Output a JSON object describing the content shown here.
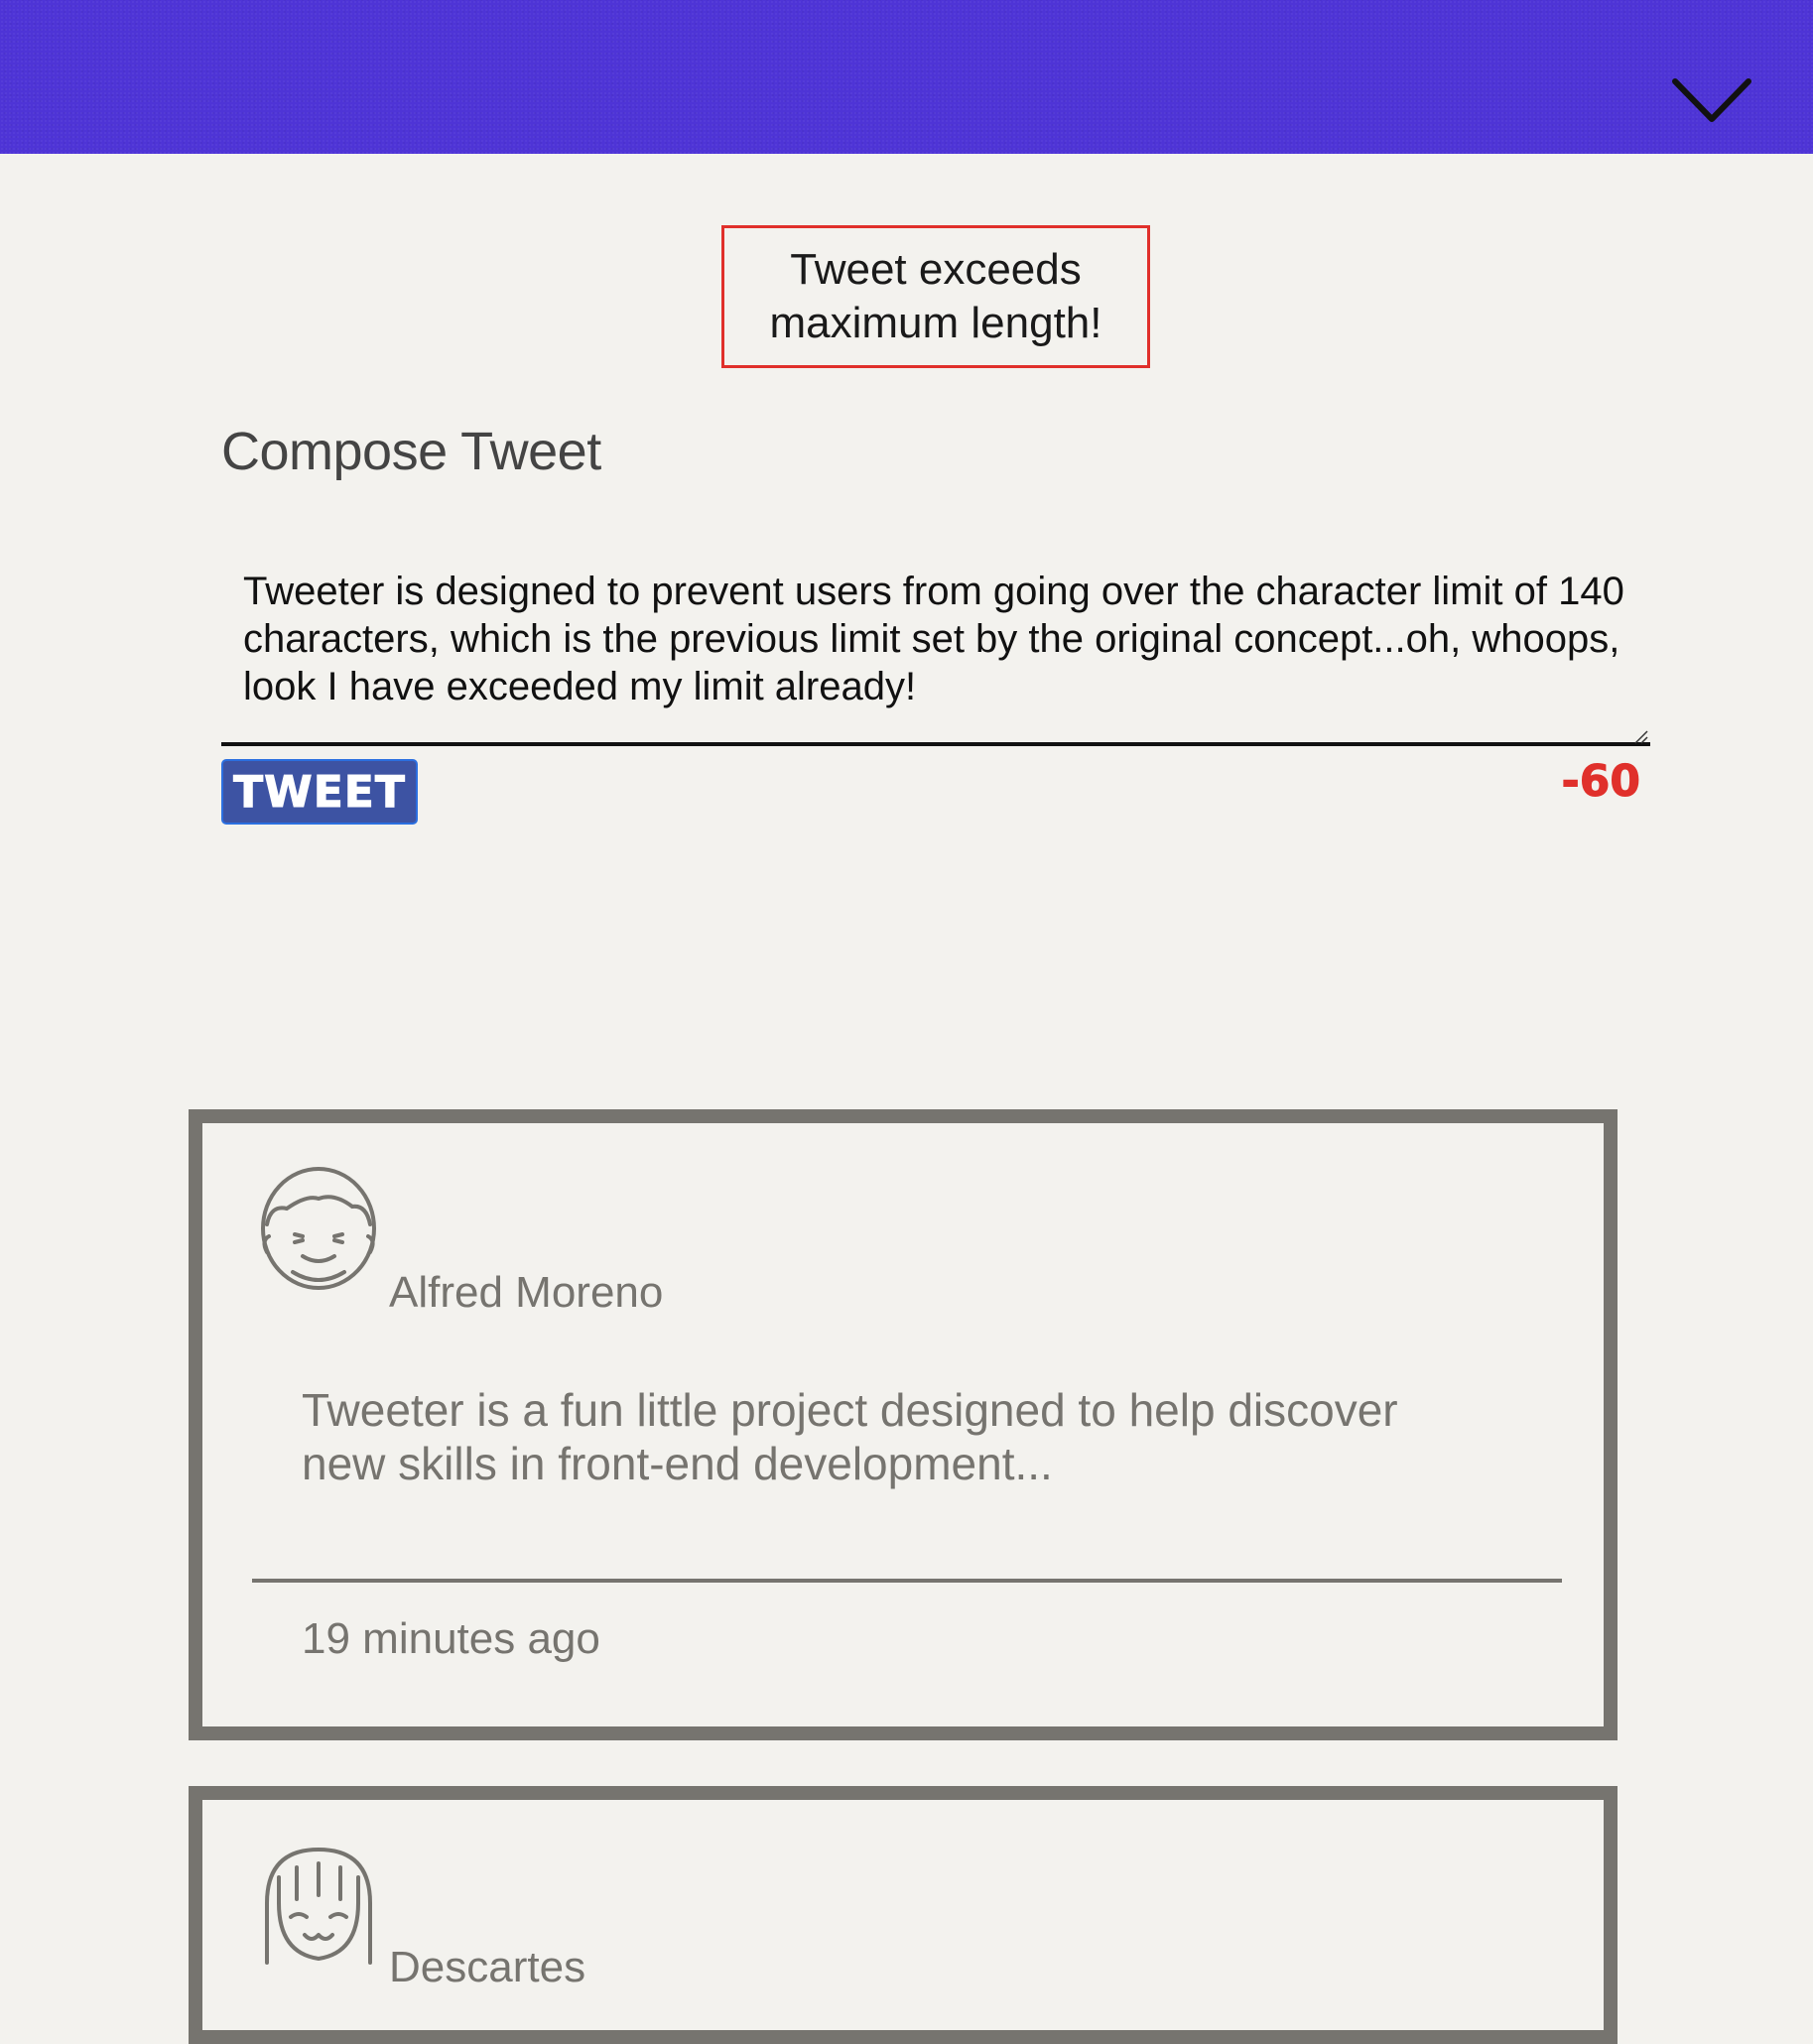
{
  "header": {
    "toggle_icon": "chevron-down-icon",
    "background_color": "#4e34d6"
  },
  "error": {
    "message": "Tweet exceeds maximum length!",
    "border_color": "#e0302b"
  },
  "compose": {
    "title": "Compose Tweet",
    "text": "Tweeter is designed to prevent users from going over the character limit of 140 characters, which is the previous limit set by the original concept...oh, whoops, look I have exceeded my limit already!",
    "button_label": "TWEET",
    "button_color": "#3d53a3",
    "counter": "-60",
    "counter_color": "#e0302b"
  },
  "tweets": [
    {
      "author": "Alfred Moreno",
      "avatar_icon": "male-avatar-icon",
      "text": "Tweeter is a fun little project designed to help discover new skills in front-end development...",
      "timestamp": "19 minutes ago"
    },
    {
      "author": "Descartes",
      "avatar_icon": "female-avatar-icon"
    }
  ]
}
